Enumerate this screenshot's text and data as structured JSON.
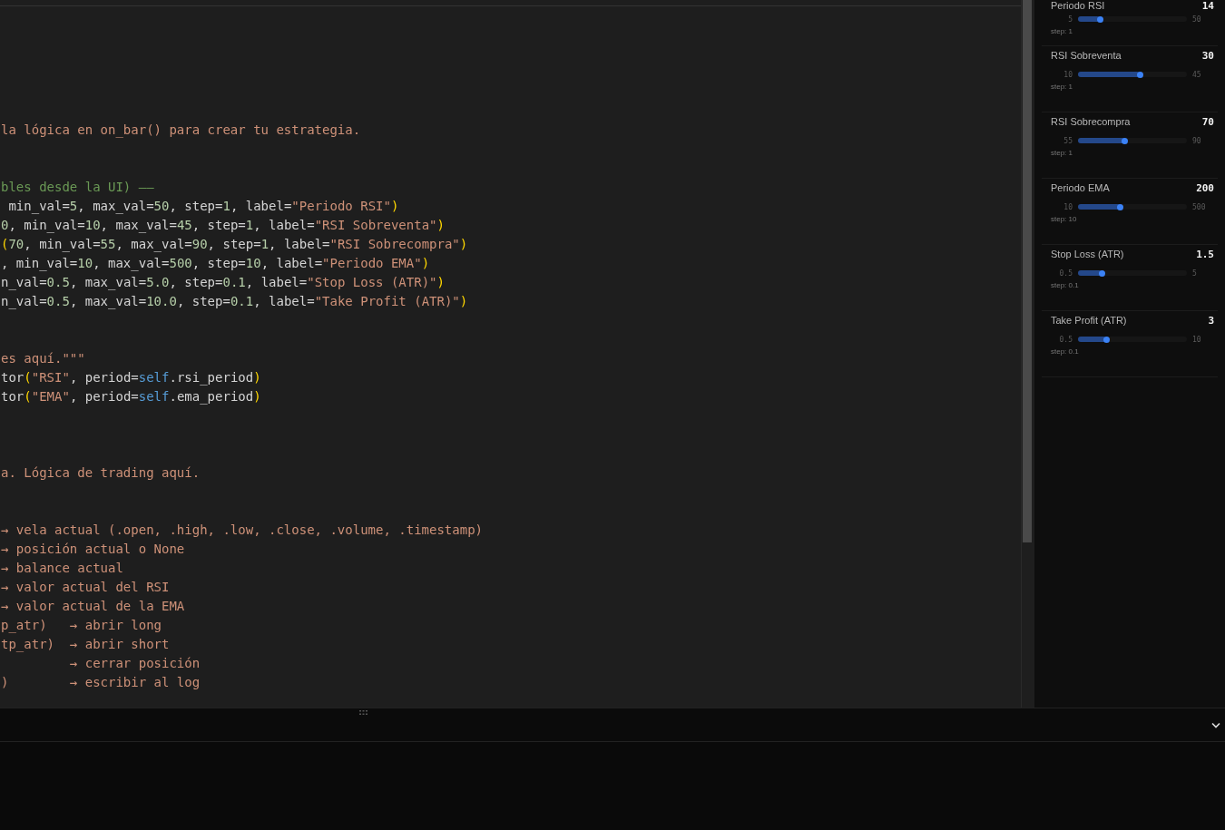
{
  "editor": {
    "lines": [
      {
        "kind": "blank"
      },
      {
        "kind": "blank"
      },
      {
        "kind": "blank"
      },
      {
        "kind": "blank"
      },
      {
        "kind": "blank"
      },
      {
        "kind": "blank"
      },
      {
        "kind": "code",
        "tokens": [
          {
            "text": "la lógica en on_bar() para crear tu estrategia.",
            "kind": "doc"
          }
        ]
      },
      {
        "kind": "blank"
      },
      {
        "kind": "blank"
      },
      {
        "kind": "code",
        "tokens": [
          {
            "text": "bles desde la UI) ——",
            "kind": "comment"
          }
        ]
      },
      {
        "kind": "code",
        "tokens": [
          {
            "text": " min_val=",
            "kind": "text"
          },
          {
            "text": "5",
            "kind": "number"
          },
          {
            "text": ", max_val=",
            "kind": "text"
          },
          {
            "text": "50",
            "kind": "number"
          },
          {
            "text": ", step=",
            "kind": "text"
          },
          {
            "text": "1",
            "kind": "number"
          },
          {
            "text": ", label=",
            "kind": "text"
          },
          {
            "text": "\"Periodo RSI\"",
            "kind": "string"
          },
          {
            "text": ")",
            "kind": "bracket"
          }
        ]
      },
      {
        "kind": "code",
        "tokens": [
          {
            "text": "0",
            "kind": "number"
          },
          {
            "text": ", min_val=",
            "kind": "text"
          },
          {
            "text": "10",
            "kind": "number"
          },
          {
            "text": ", max_val=",
            "kind": "text"
          },
          {
            "text": "45",
            "kind": "number"
          },
          {
            "text": ", step=",
            "kind": "text"
          },
          {
            "text": "1",
            "kind": "number"
          },
          {
            "text": ", label=",
            "kind": "text"
          },
          {
            "text": "\"RSI Sobreventa\"",
            "kind": "string"
          },
          {
            "text": ")",
            "kind": "bracket"
          }
        ]
      },
      {
        "kind": "code",
        "tokens": [
          {
            "text": "(",
            "kind": "bracket"
          },
          {
            "text": "70",
            "kind": "number"
          },
          {
            "text": ", min_val=",
            "kind": "text"
          },
          {
            "text": "55",
            "kind": "number"
          },
          {
            "text": ", max_val=",
            "kind": "text"
          },
          {
            "text": "90",
            "kind": "number"
          },
          {
            "text": ", step=",
            "kind": "text"
          },
          {
            "text": "1",
            "kind": "number"
          },
          {
            "text": ", label=",
            "kind": "text"
          },
          {
            "text": "\"RSI Sobrecompra\"",
            "kind": "string"
          },
          {
            "text": ")",
            "kind": "bracket"
          }
        ]
      },
      {
        "kind": "code",
        "tokens": [
          {
            "text": ", min_val=",
            "kind": "text"
          },
          {
            "text": "10",
            "kind": "number"
          },
          {
            "text": ", max_val=",
            "kind": "text"
          },
          {
            "text": "500",
            "kind": "number"
          },
          {
            "text": ", step=",
            "kind": "text"
          },
          {
            "text": "10",
            "kind": "number"
          },
          {
            "text": ", label=",
            "kind": "text"
          },
          {
            "text": "\"Periodo EMA\"",
            "kind": "string"
          },
          {
            "text": ")",
            "kind": "bracket"
          }
        ]
      },
      {
        "kind": "code",
        "tokens": [
          {
            "text": "n_val=",
            "kind": "text"
          },
          {
            "text": "0.5",
            "kind": "number"
          },
          {
            "text": ", max_val=",
            "kind": "text"
          },
          {
            "text": "5.0",
            "kind": "number"
          },
          {
            "text": ", step=",
            "kind": "text"
          },
          {
            "text": "0.1",
            "kind": "number"
          },
          {
            "text": ", label=",
            "kind": "text"
          },
          {
            "text": "\"Stop Loss (ATR)\"",
            "kind": "string"
          },
          {
            "text": ")",
            "kind": "bracket"
          }
        ]
      },
      {
        "kind": "code",
        "tokens": [
          {
            "text": "n_val=",
            "kind": "text"
          },
          {
            "text": "0.5",
            "kind": "number"
          },
          {
            "text": ", max_val=",
            "kind": "text"
          },
          {
            "text": "10.0",
            "kind": "number"
          },
          {
            "text": ", step=",
            "kind": "text"
          },
          {
            "text": "0.1",
            "kind": "number"
          },
          {
            "text": ", label=",
            "kind": "text"
          },
          {
            "text": "\"Take Profit (ATR)\"",
            "kind": "string"
          },
          {
            "text": ")",
            "kind": "bracket"
          }
        ]
      },
      {
        "kind": "blank"
      },
      {
        "kind": "blank"
      },
      {
        "kind": "code",
        "tokens": [
          {
            "text": "es aquí.\"\"\"",
            "kind": "doc"
          }
        ]
      },
      {
        "kind": "code",
        "tokens": [
          {
            "text": "tor",
            "kind": "text"
          },
          {
            "text": "(",
            "kind": "bracket"
          },
          {
            "text": "\"RSI\"",
            "kind": "string"
          },
          {
            "text": ", period=",
            "kind": "text"
          },
          {
            "text": "self",
            "kind": "keyword"
          },
          {
            "text": ".rsi_period",
            "kind": "text"
          },
          {
            "text": ")",
            "kind": "bracket"
          }
        ]
      },
      {
        "kind": "code",
        "tokens": [
          {
            "text": "tor",
            "kind": "text"
          },
          {
            "text": "(",
            "kind": "bracket"
          },
          {
            "text": "\"EMA\"",
            "kind": "string"
          },
          {
            "text": ", period=",
            "kind": "text"
          },
          {
            "text": "self",
            "kind": "keyword"
          },
          {
            "text": ".ema_period",
            "kind": "text"
          },
          {
            "text": ")",
            "kind": "bracket"
          }
        ]
      },
      {
        "kind": "blank"
      },
      {
        "kind": "blank"
      },
      {
        "kind": "blank"
      },
      {
        "kind": "code",
        "tokens": [
          {
            "text": "a. Lógica de trading aquí.",
            "kind": "doc"
          }
        ]
      },
      {
        "kind": "blank"
      },
      {
        "kind": "blank"
      },
      {
        "kind": "code",
        "tokens": [
          {
            "text": "→ vela actual (.open, .high, .low, .close, .volume, .timestamp)",
            "kind": "doc"
          }
        ]
      },
      {
        "kind": "code",
        "tokens": [
          {
            "text": "→ posición actual o None",
            "kind": "doc"
          }
        ]
      },
      {
        "kind": "code",
        "tokens": [
          {
            "text": "→ balance actual",
            "kind": "doc"
          }
        ]
      },
      {
        "kind": "code",
        "tokens": [
          {
            "text": "→ valor actual del RSI",
            "kind": "doc"
          }
        ]
      },
      {
        "kind": "code",
        "tokens": [
          {
            "text": "→ valor actual de la EMA",
            "kind": "doc"
          }
        ]
      },
      {
        "kind": "code",
        "tokens": [
          {
            "text": "p_atr)   → abrir long",
            "kind": "doc"
          }
        ]
      },
      {
        "kind": "code",
        "tokens": [
          {
            "text": "tp_atr)  → abrir short",
            "kind": "doc"
          }
        ]
      },
      {
        "kind": "code",
        "tokens": [
          {
            "text": "         → cerrar posición",
            "kind": "doc"
          }
        ]
      },
      {
        "kind": "code",
        "tokens": [
          {
            "text": ")        → escribir al log",
            "kind": "doc"
          }
        ]
      }
    ]
  },
  "parameters": [
    {
      "label": "Periodo RSI",
      "value": "14",
      "min": "5",
      "max": "50",
      "step": "step: 1",
      "level": 0.2
    },
    {
      "label": "RSI Sobreventa",
      "value": "30",
      "min": "10",
      "max": "45",
      "step": "step: 1",
      "level": 0.57
    },
    {
      "label": "RSI Sobrecompra",
      "value": "70",
      "min": "55",
      "max": "90",
      "step": "step: 1",
      "level": 0.43
    },
    {
      "label": "Periodo EMA",
      "value": "200",
      "min": "10",
      "max": "500",
      "step": "step: 10",
      "level": 0.39
    },
    {
      "label": "Stop Loss (ATR)",
      "value": "1.5",
      "min": "0.5",
      "max": "5",
      "step": "step: 0.1",
      "level": 0.22
    },
    {
      "label": "Take Profit (ATR)",
      "value": "3",
      "min": "0.5",
      "max": "10",
      "step": "step: 0.1",
      "level": 0.26
    }
  ]
}
